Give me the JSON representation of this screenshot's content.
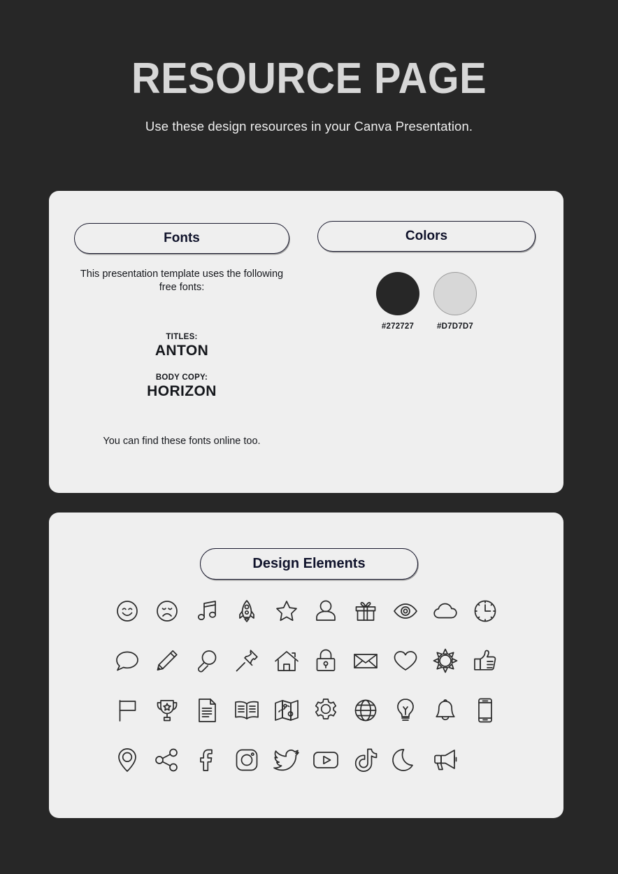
{
  "header": {
    "title": "RESOURCE PAGE",
    "subtitle": "Use these design resources in your Canva Presentation."
  },
  "fonts_card": {
    "pill_label": "Fonts",
    "intro": "This presentation template uses the following free fonts:",
    "titles_label": "TITLES:",
    "titles_font": "ANTON",
    "body_label": "BODY COPY:",
    "body_font": "HORIZON",
    "footer": "You can find these fonts online too."
  },
  "colors_card": {
    "pill_label": "Colors",
    "swatches": [
      {
        "hex": "#272727",
        "label": "#272727"
      },
      {
        "hex": "#D7D7D7",
        "label": "#D7D7D7"
      }
    ]
  },
  "elements_card": {
    "pill_label": "Design Elements",
    "icons": [
      "smile-face-icon",
      "sad-face-icon",
      "music-note-icon",
      "rocket-icon",
      "star-icon",
      "person-icon",
      "gift-icon",
      "eye-icon",
      "cloud-icon",
      "clock-icon",
      "speech-bubble-icon",
      "pencil-icon",
      "magnifier-icon",
      "pushpin-icon",
      "house-icon",
      "lock-icon",
      "envelope-icon",
      "heart-icon",
      "sun-icon",
      "thumbs-up-icon",
      "flag-icon",
      "trophy-icon",
      "document-icon",
      "open-book-icon",
      "map-icon",
      "gear-icon",
      "globe-icon",
      "lightbulb-icon",
      "bell-icon",
      "phone-icon",
      "location-pin-icon",
      "share-icon",
      "facebook-icon",
      "instagram-icon",
      "twitter-icon",
      "youtube-icon",
      "tiktok-icon",
      "moon-icon",
      "megaphone-icon"
    ]
  },
  "theme": {
    "background": "#272727",
    "card_background": "#EFEFEF",
    "title_color": "#D7D7D7",
    "ink": "#10132b"
  }
}
